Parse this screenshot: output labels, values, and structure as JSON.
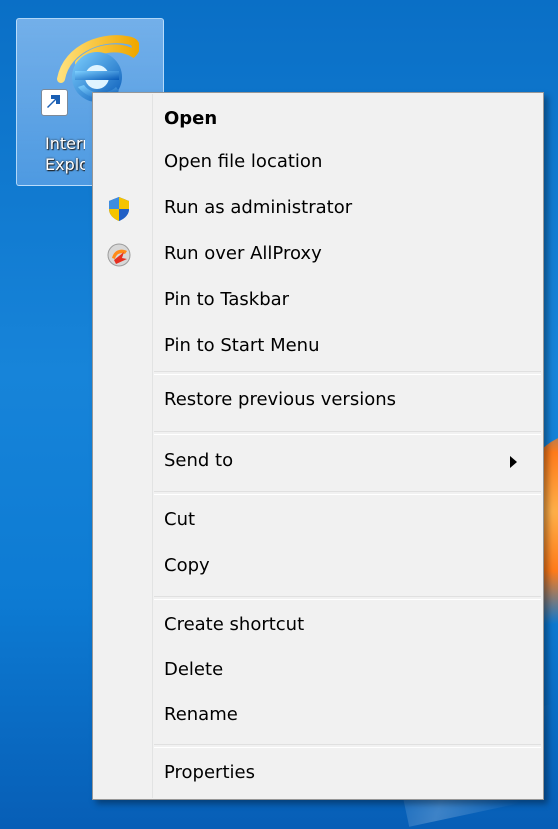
{
  "desktop": {
    "icon": {
      "label_line_1": "Internet",
      "label_line_2": "Explorer"
    }
  },
  "context_menu": {
    "items": [
      {
        "label": "Open",
        "bold": true
      },
      {
        "label": "Open file location"
      },
      {
        "label": "Run as administrator",
        "icon": "uac-shield-icon"
      },
      {
        "label": "Run over AllProxy",
        "icon": "allproxy-icon"
      },
      {
        "label": "Pin to Taskbar"
      },
      {
        "label": "Pin to Start Menu"
      },
      {
        "label": "Restore previous versions"
      },
      {
        "label": "Send to",
        "has_submenu": true
      },
      {
        "label": "Cut"
      },
      {
        "label": "Copy"
      },
      {
        "label": "Create shortcut"
      },
      {
        "label": "Delete"
      },
      {
        "label": "Rename"
      },
      {
        "label": "Properties"
      }
    ]
  },
  "colors": {
    "desktop_blue": "#1784d9",
    "menu_background": "#f1f1f1",
    "menu_border": "#979797",
    "separator": "#e0e0e0",
    "text": "#000000"
  }
}
